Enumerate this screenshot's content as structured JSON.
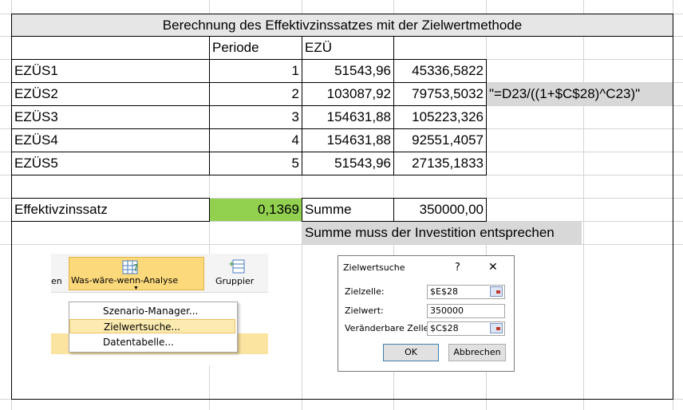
{
  "sheet": {
    "title": "Berechnung des Effektivzinssatzes mit der Zielwertmethode",
    "headers": {
      "periode": "Periode",
      "ezu": "EZÜ"
    },
    "rows": [
      {
        "label": "EZÜS1",
        "periode": "1",
        "ezu": "51543,96",
        "barwert": "45336,5822"
      },
      {
        "label": "EZÜS2",
        "periode": "2",
        "ezu": "103087,92",
        "barwert": "79753,5032"
      },
      {
        "label": "EZÜS3",
        "periode": "3",
        "ezu": "154631,88",
        "barwert": "105223,326"
      },
      {
        "label": "EZÜS4",
        "periode": "4",
        "ezu": "154631,88",
        "barwert": "92551,4057"
      },
      {
        "label": "EZÜS5",
        "periode": "5",
        "ezu": "51543,96",
        "barwert": "27135,1833"
      }
    ],
    "formula_note": "\"=D23/((1+$C$28)^C23)\"",
    "effektiv_label": "Effektivzinssatz",
    "effektiv_value": "0,1369",
    "summe_label": "Summe",
    "summe_value": "350000,00",
    "note": "Summe muss der Investition entsprechen"
  },
  "ribbon": {
    "left_fragment": "en",
    "whatif_label": "Was-wäre-wenn-Analyse",
    "group_label": "Gruppier",
    "menu_items": [
      "Szenario-Manager...",
      "Zielwertsuche...",
      "Datentabelle..."
    ]
  },
  "dialog": {
    "title": "Zielwertsuche",
    "help": "?",
    "close": "✕",
    "zielzelle_label": "Zielzelle:",
    "zielzelle_value": "$E$28",
    "zielwert_label": "Zielwert:",
    "zielwert_value": "350000",
    "veraenderbar_label": "Veränderbare Zelle:",
    "veraenderbar_value": "$C$28",
    "ok": "OK",
    "cancel": "Abbrechen"
  },
  "colors": {
    "highlight_green": "#92d050",
    "title_gray": "#e6e6e6",
    "menu_orange": "#fcd97b"
  }
}
